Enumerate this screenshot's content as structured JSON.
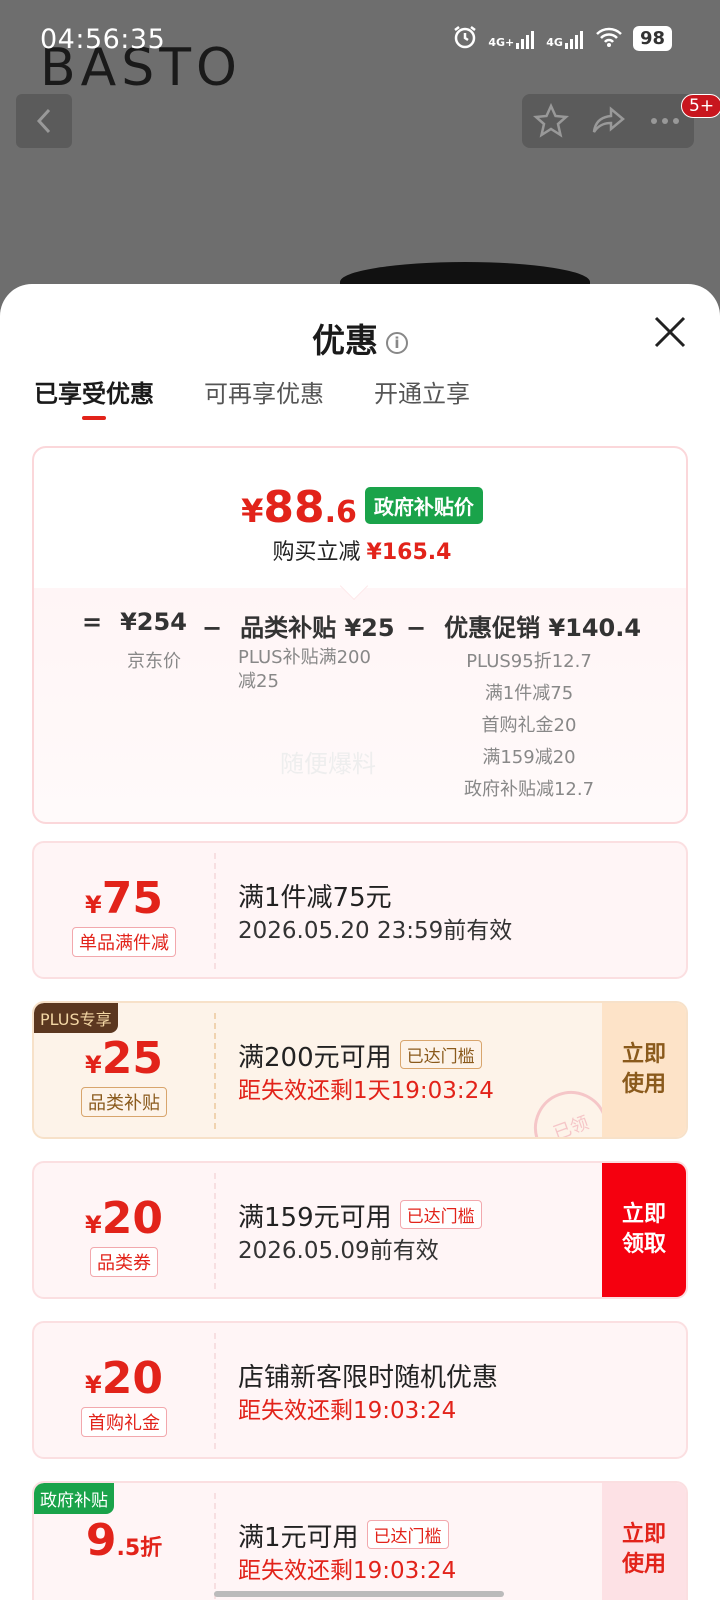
{
  "status_bar": {
    "time": "04:56:35",
    "signal1": "4G+",
    "signal2": "4G",
    "battery": "98"
  },
  "header": {
    "brand": "BASTO",
    "notification_badge": "5+"
  },
  "sheet": {
    "title": "优惠",
    "tabs": [
      {
        "label": "已享受优惠",
        "active": true
      },
      {
        "label": "可再享优惠",
        "active": false
      },
      {
        "label": "开通立享",
        "active": false
      }
    ]
  },
  "summary": {
    "price_symbol": "¥",
    "price_int": "88",
    "price_dec": ".6",
    "price_tag": "政府补贴价",
    "save_label": "购买立减",
    "save_value": "¥165.4",
    "eq": "=",
    "jd_price": "¥254",
    "jd_label": "京东价",
    "minus1": "−",
    "category_label": "品类补贴 ¥25",
    "category_sub_1": "PLUS补贴满200",
    "category_sub_2": "减25",
    "minus2": "−",
    "promo_label": "优惠促销 ¥140.4",
    "promo_items": [
      "PLUS95折12.7",
      "满1件减75",
      "首购礼金20",
      "满159减20",
      "政府补贴减12.7"
    ],
    "watermark": "随便爆料"
  },
  "coupons": [
    {
      "symbol": "¥",
      "amount": "75",
      "tag": "单品满件减",
      "line1": "满1件减75元",
      "line2": "2026.05.20 23:59前有效"
    },
    {
      "symbol": "¥",
      "amount": "25",
      "tag": "品类补贴",
      "corner": "PLUS专享",
      "line1": "满200元可用",
      "reach": "已达门槛",
      "line2": "距失效还剩1天19:03:24",
      "action": [
        "立即",
        "使用"
      ],
      "stamp": "已领"
    },
    {
      "symbol": "¥",
      "amount": "20",
      "tag": "品类券",
      "line1": "满159元可用",
      "reach": "已达门槛",
      "line2": "2026.05.09前有效",
      "action": [
        "立即",
        "领取"
      ]
    },
    {
      "symbol": "¥",
      "amount": "20",
      "tag": "首购礼金",
      "line1": "店铺新客限时随机优惠",
      "line2": "距失效还剩19:03:24"
    },
    {
      "amount": "9",
      "suffix": ".5折",
      "corner": "政府补贴",
      "line1": "满1元可用",
      "reach": "已达门槛",
      "line2": "距失效还剩19:03:24",
      "action": [
        "立即",
        "使用"
      ]
    }
  ]
}
